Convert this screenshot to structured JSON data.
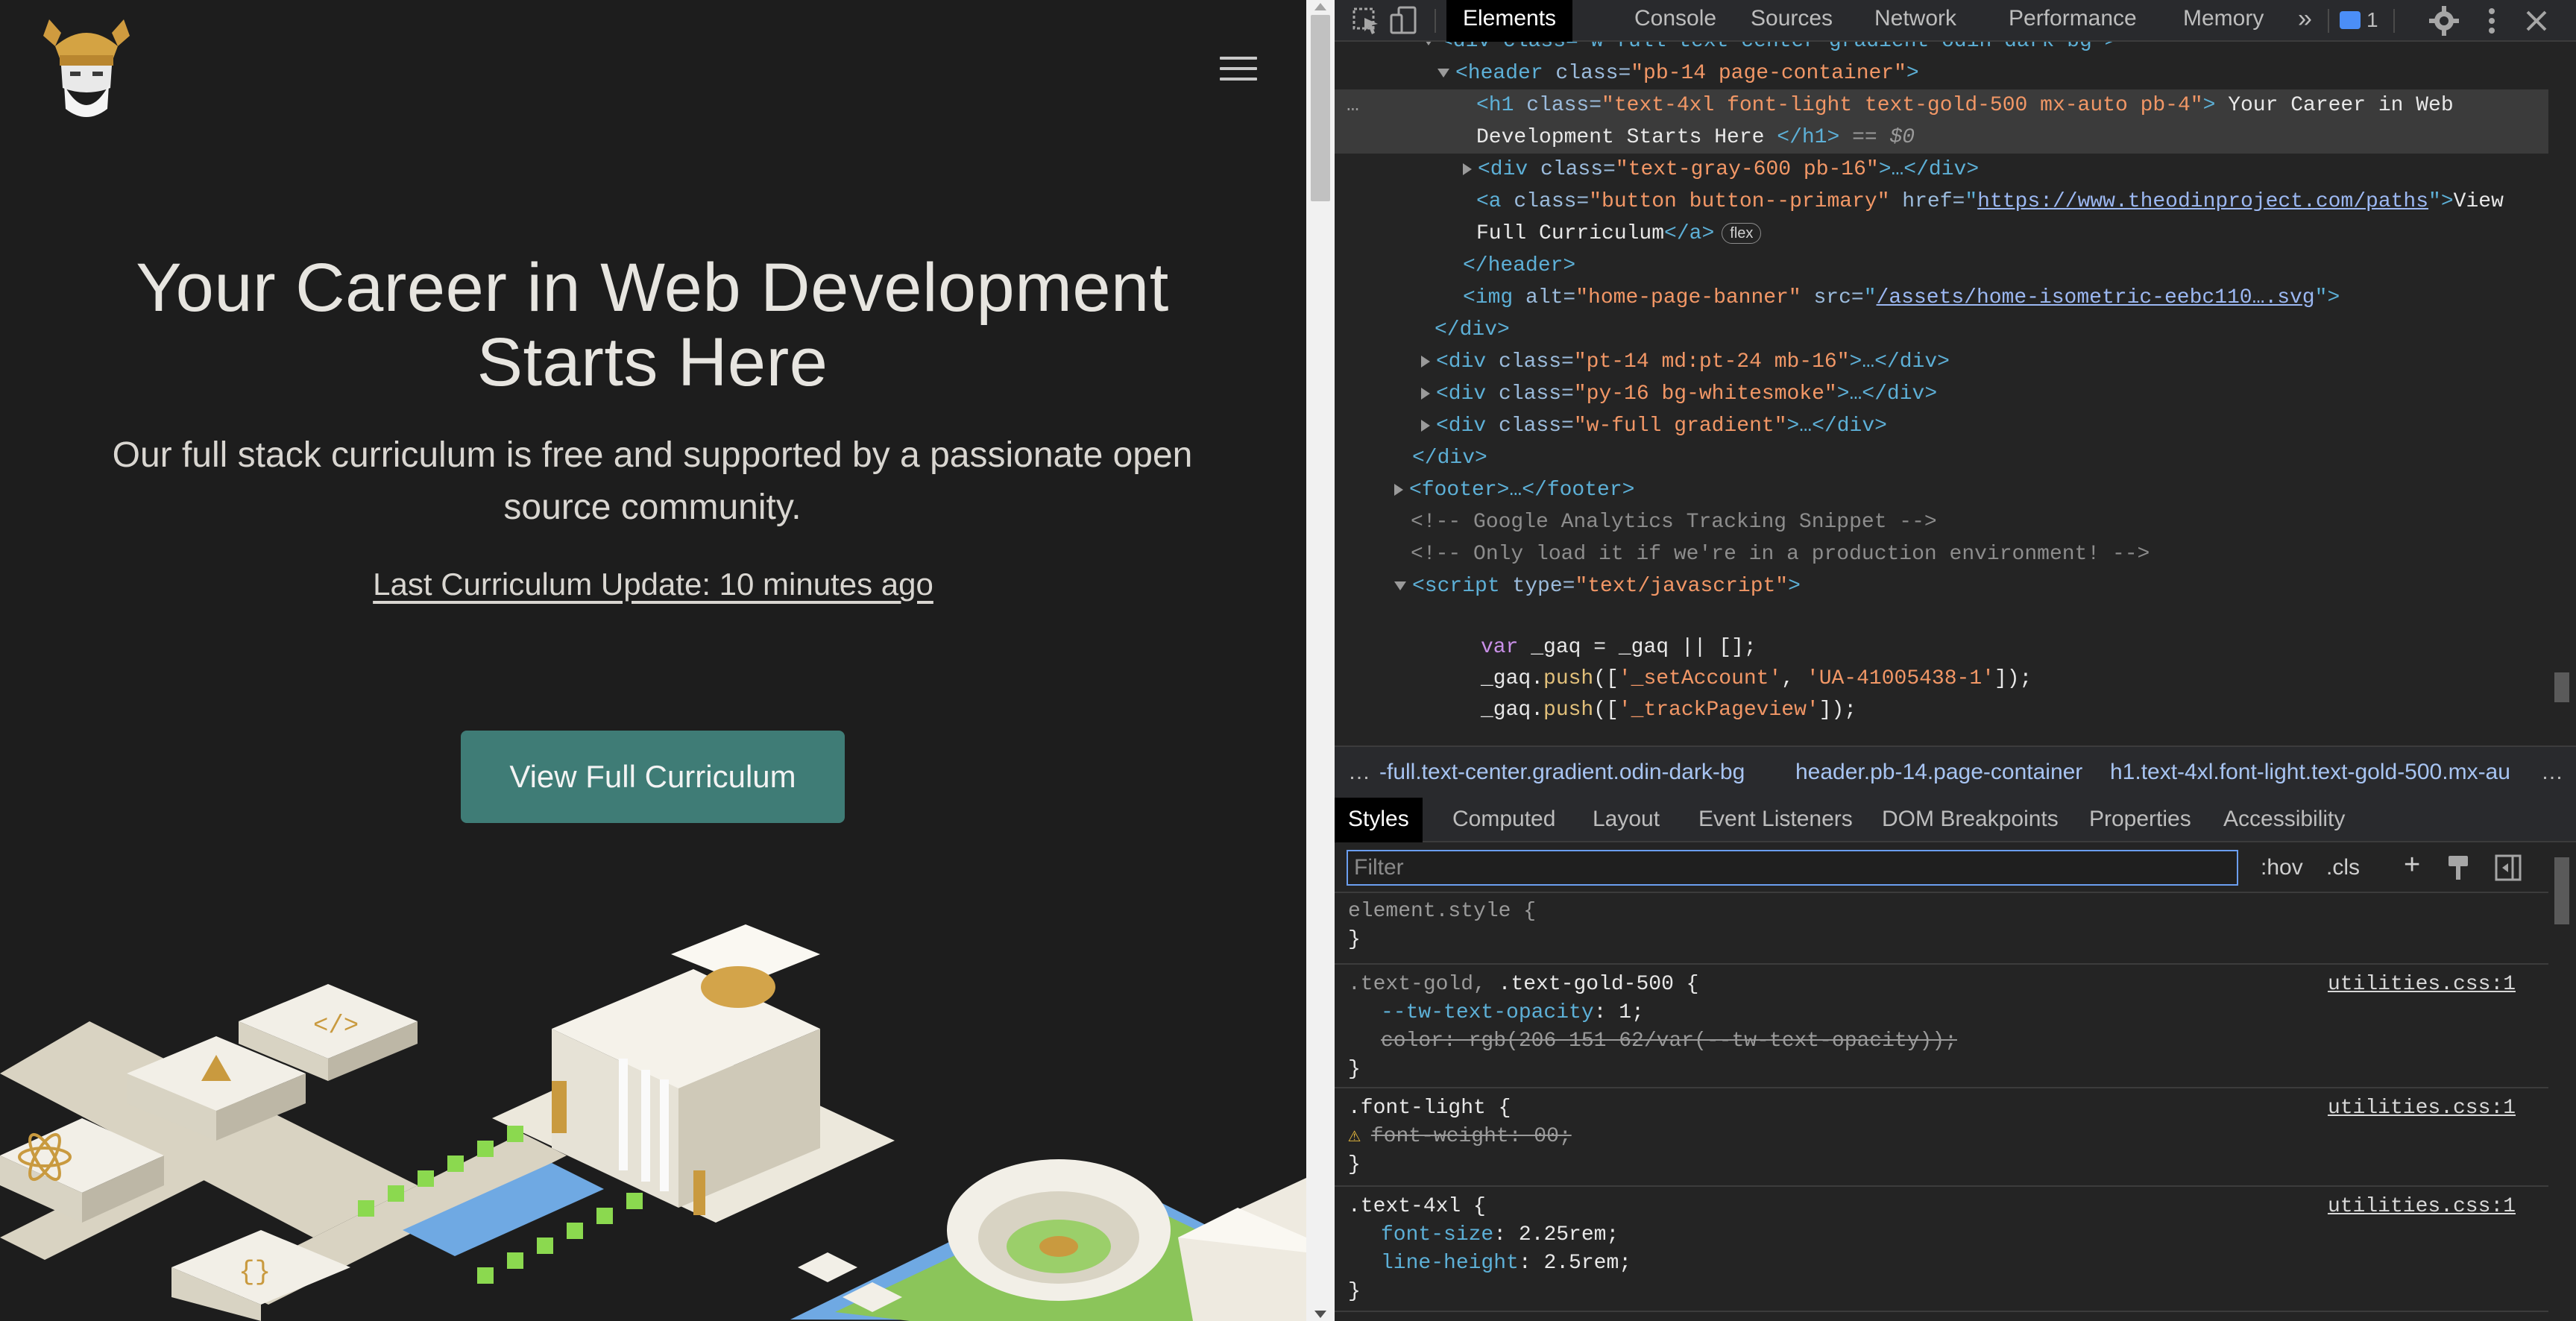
{
  "page": {
    "hero_title": "Your Career in Web Development Starts Here",
    "hero_subtitle": "Our full stack curriculum is free and supported by a passionate open source community.",
    "update_link": "Last Curriculum Update: 10 minutes ago",
    "cta_label": "View Full Curriculum"
  },
  "devtools": {
    "tabs": [
      "Elements",
      "Console",
      "Sources",
      "Network",
      "Performance",
      "Memory"
    ],
    "more_tabs": "»",
    "issues_count": "1",
    "dom": {
      "l0": "<div class=\"w-full text-center gradient odin-dark-bg\">",
      "l1_tag": "<header",
      "l1_attr": " class=",
      "l1_val": "\"pb-14 page-container\"",
      "l1_end": ">",
      "l2_open": "<h1",
      "l2_attr": " class=",
      "l2_val": "\"text-4xl font-light text-gold-500 mx-auto pb-4\"",
      "l2_close": ">",
      "l2_text": " Your Career in Web",
      "l3_text": "Development Starts Here ",
      "l3_end": "</h1>",
      "l3_eq": " == $0",
      "l4_tag": "<div",
      "l4_attr": " class=",
      "l4_val": "\"text-gray-600 pb-16\"",
      "l4_end": ">…</div>",
      "l5_tag": "<a",
      "l5_attr": " class=",
      "l5_val": "\"button button--primary\"",
      "l5_attr2": " href=",
      "l5_href": "https://www.theodinproject.com/paths",
      "l5_end": ">",
      "l5_text": "View",
      "l6_text": "Full Curriculum",
      "l6_end": "</a>",
      "l6_pill": "flex",
      "l7": "</header>",
      "l8_tag": "<img",
      "l8_attr": " alt=",
      "l8_val": "\"home-page-banner\"",
      "l8_attr2": " src=",
      "l8_src": "/assets/home-isometric-eebc110….svg",
      "l8_end": ">",
      "l9": "</div>",
      "l10_tag": "<div",
      "l10_attr": " class=",
      "l10_val": "\"pt-14 md:pt-24 mb-16\"",
      "l10_end": ">…</div>",
      "l11_val": "\"py-16 bg-whitesmoke\"",
      "l12_val": "\"w-full gradient\"",
      "l13": "</div>",
      "l14": "<footer>…</footer>",
      "l15": "<!-- Google Analytics Tracking Snippet -->",
      "l16": "<!-- Only load it if we're in a production environment! -->",
      "l17_tag": "<script",
      "l17_attr": " type=",
      "l17_val": "\"text/javascript\"",
      "l17_end": ">",
      "l18_kw": "var",
      "l18_rest": " _gaq = _gaq || [];",
      "l19_a": "_gaq.",
      "l19_fn": "push",
      "l19_b": "([",
      "l19_s1": "'_setAccount'",
      "l19_c": ", ",
      "l19_s2": "'UA-41005438-1'",
      "l19_d": "]);",
      "l20_a": "_gaq.",
      "l20_fn": "push",
      "l20_b": "([",
      "l20_s1": "'_trackPageview'",
      "l20_d": "]);"
    },
    "breadcrumbs": [
      "…",
      "-full.text-center.gradient.odin-dark-bg",
      "header.pb-14.page-container",
      "h1.text-4xl.font-light.text-gold-500.mx-au",
      "…"
    ],
    "sub_tabs": [
      "Styles",
      "Computed",
      "Layout",
      "Event Listeners",
      "DOM Breakpoints",
      "Properties",
      "Accessibility"
    ],
    "filter_placeholder": "Filter",
    "hov_label": ":hov",
    "cls_label": ".cls",
    "plus_label": "+",
    "styles": {
      "r0_sel": "element.style {",
      "r0_close": "}",
      "r1_sel_a": ".text-gold, ",
      "r1_sel_b": ".text-gold-500 {",
      "r1_src": "utilities.css:1",
      "r1_p1": "--tw-text-opacity",
      "r1_v1": ": 1;",
      "r1_p2": "color",
      "r1_v2": ": rgb(206 151 62/var(--tw-text-opacity));",
      "r1_close": "}",
      "r2_sel": ".font-light {",
      "r2_src": "utilities.css:1",
      "r2_warn": "⚠",
      "r2_p1": "font-weight",
      "r2_v1": ": 00;",
      "r2_close": "}",
      "r3_sel": ".text-4xl {",
      "r3_src": "utilities.css:1",
      "r3_p1": "font-size",
      "r3_v1": ": 2.25rem;",
      "r3_p2": "line-height",
      "r3_v2": ": 2.5rem;",
      "r3_close": "}"
    }
  },
  "colors": {
    "page_bg": "#1d1d1d",
    "cta_bg": "#3f7c76",
    "gold": "#ce973e",
    "devtools_bg": "#242424"
  },
  "icons": [
    "odin-logo-icon",
    "hamburger-menu-icon",
    "inspect-element-icon",
    "device-toggle-icon",
    "issues-icon",
    "settings-gear-icon",
    "kebab-menu-icon",
    "close-icon",
    "new-style-rule-icon",
    "paint-brush-icon",
    "sidebar-toggle-icon"
  ]
}
